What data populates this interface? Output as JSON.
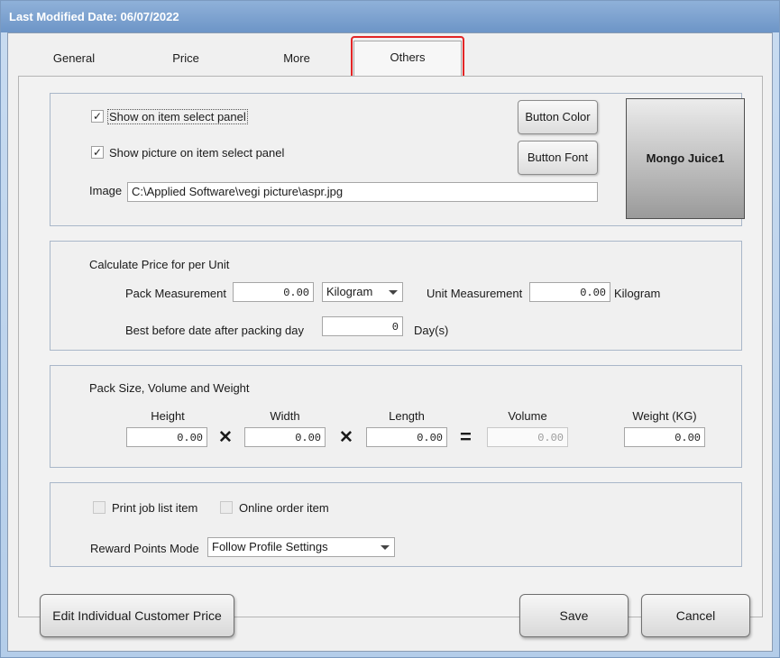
{
  "window": {
    "title": "Last Modified Date: 06/07/2022"
  },
  "tabs": [
    {
      "label": "General",
      "active": false
    },
    {
      "label": "Price",
      "active": false
    },
    {
      "label": "More",
      "active": false
    },
    {
      "label": "Others",
      "active": true
    }
  ],
  "display": {
    "show_on_panel": {
      "label": "Show on item select panel",
      "checked": true
    },
    "show_picture": {
      "label": "Show picture on item select panel",
      "checked": true
    },
    "image_label": "Image",
    "image_path": "C:\\Applied Software\\vegi picture\\aspr.jpg",
    "button_color_label": "Button Color",
    "button_font_label": "Button Font",
    "preview_text": "Mongo Juice1"
  },
  "unit_price": {
    "title": "Calculate Price for per Unit",
    "pack_measurement_label": "Pack Measurement",
    "pack_measurement_value": "0.00",
    "pack_unit": "Kilogram",
    "unit_measurement_label": "Unit Measurement",
    "unit_measurement_value": "0.00",
    "unit_measurement_unit": "Kilogram",
    "best_before_label": "Best before date after packing day",
    "best_before_value": "0",
    "best_before_unit": "Day(s)"
  },
  "pack_size": {
    "title": "Pack Size,  Volume and Weight",
    "height_label": "Height",
    "width_label": "Width",
    "length_label": "Length",
    "volume_label": "Volume",
    "weight_label": "Weight (KG)",
    "height": "0.00",
    "width": "0.00",
    "length": "0.00",
    "volume": "0.00",
    "weight": "0.00",
    "times_symbol": "✕",
    "equals_symbol": "="
  },
  "options": {
    "print_job": {
      "label": "Print job list item",
      "checked": false
    },
    "online_order": {
      "label": "Online order item",
      "checked": false
    },
    "reward_label": "Reward Points Mode",
    "reward_value": "Follow Profile Settings"
  },
  "footer": {
    "edit_price_label": "Edit Individual Customer Price",
    "save_label": "Save",
    "cancel_label": "Cancel"
  },
  "colors": {
    "title_bar": "#7ba0cf",
    "active_tab_highlight": "#e32526"
  }
}
